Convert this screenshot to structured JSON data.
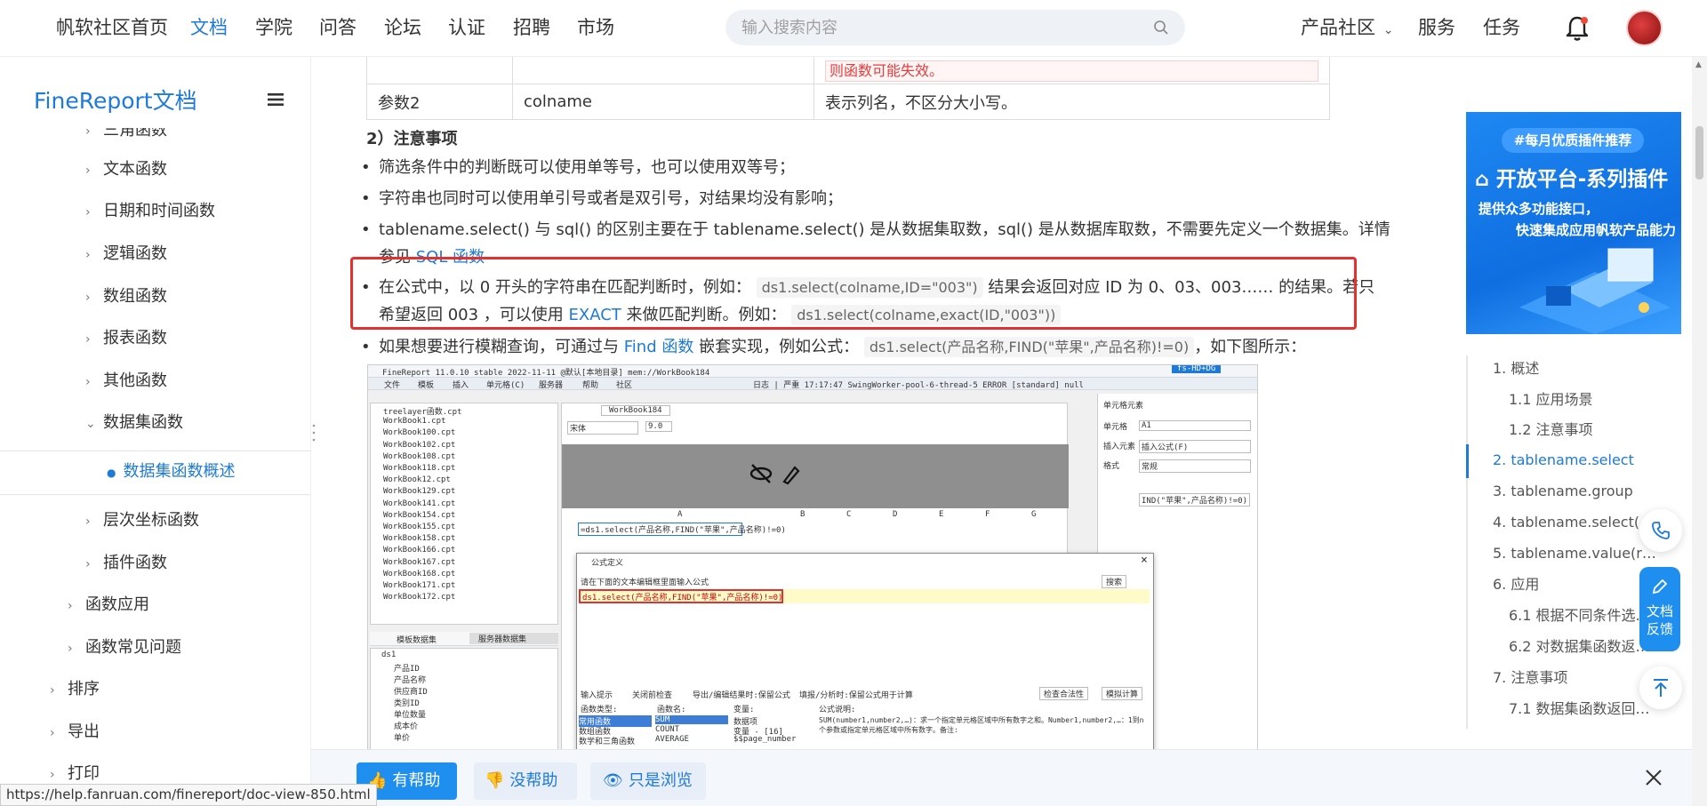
{
  "topnav": {
    "items": [
      "帆软社区首页",
      "文档",
      "学院",
      "问答",
      "论坛",
      "认证",
      "招聘",
      "市场"
    ],
    "active_index": 1,
    "search_placeholder": "输入搜索内容",
    "right_items": [
      "产品社区",
      "服务",
      "任务"
    ],
    "accent": "#1e7ad8"
  },
  "sidebar": {
    "title": "FineReport文档",
    "items": [
      {
        "label": "三角函数",
        "indent": 2
      },
      {
        "label": "文本函数",
        "indent": 2
      },
      {
        "label": "日期和时间函数",
        "indent": 2
      },
      {
        "label": "逻辑函数",
        "indent": 2
      },
      {
        "label": "数组函数",
        "indent": 2
      },
      {
        "label": "报表函数",
        "indent": 2
      },
      {
        "label": "其他函数",
        "indent": 2
      },
      {
        "label": "数据集函数",
        "indent": 2,
        "expanded": true
      },
      {
        "label": "数据集函数概述",
        "indent": 3,
        "active": true
      },
      {
        "label": "层次坐标函数",
        "indent": 2
      },
      {
        "label": "插件函数",
        "indent": 2
      },
      {
        "label": "函数应用",
        "indent": 1
      },
      {
        "label": "函数常见问题",
        "indent": 1
      },
      {
        "label": "排序",
        "indent": 0
      },
      {
        "label": "导出",
        "indent": 0
      },
      {
        "label": "打印",
        "indent": 0
      }
    ]
  },
  "content": {
    "param_table": {
      "row_warning": "则函数可能失效。",
      "row": {
        "name": "参数2",
        "param": "colname",
        "desc": "表示列名，不区分大小写。"
      }
    },
    "section_heading": "2）注意事项",
    "bullets": {
      "b1": "筛选条件中的判断既可以使用单等号，也可以使用双等号；",
      "b2": "字符串也同时可以使用单引号或者是双引号，对结果均没有影响；",
      "b3_line1": "tablename.select() 与 sql() 的区别主要在于 tablename.select() 是从数据集取数，sql() 是从数据库取数，不需要先定义一个数据集。详情",
      "b3_prefix": "参见 ",
      "b3_link": "SQL 函数",
      "b4_a": "在公式中，以 0 开头的字符串在匹配判断时，例如：",
      "b4_code1": "ds1.select(colname,ID=\"003\")",
      "b4_b": " 结果会返回对应 ID 为 0、03、003…… 的结果。若只",
      "b4_c": "希望返回 003 ，可以使用 ",
      "b4_link": "EXACT",
      "b4_d": " 来做匹配判断。例如：",
      "b4_code2": "ds1.select(colname,exact(ID,\"003\"))",
      "b5_a": "如果想要进行模糊查询，可通过与 ",
      "b5_link": "Find 函数",
      "b5_b": " 嵌套实现，例如公式：",
      "b5_code": "ds1.select(产品名称,FIND(\"苹果\",产品名称)!=0)",
      "b5_c": "，如下图所示："
    },
    "screenshot": {
      "title": "FineReport 11.0.10 stable 2022-11-11 @默认[本地目录] mem://WorkBook184",
      "menu": [
        "文件",
        "模板",
        "插入",
        "单元格(C)",
        "服务器",
        "帮助",
        "社区"
      ],
      "log_text": "日志 | 严重 17:17:47 SwingWorker-pool-6-thread-5 ERROR [standard] null",
      "tab_label": "WorkBook184",
      "font_name": "宋体",
      "font_size": "9.0",
      "files": [
        "treelayer函数.cpt",
        "WorkBook1.cpt",
        "WorkBook100.cpt",
        "WorkBook102.cpt",
        "WorkBook108.cpt",
        "WorkBook118.cpt",
        "WorkBook12.cpt",
        "WorkBook129.cpt",
        "WorkBook141.cpt",
        "WorkBook154.cpt",
        "WorkBook155.cpt",
        "WorkBook158.cpt",
        "WorkBook166.cpt",
        "WorkBook167.cpt",
        "WorkBook168.cpt",
        "WorkBook171.cpt",
        "WorkBook172.cpt"
      ],
      "ds_tabs": [
        "模板数据集",
        "服务器数据集"
      ],
      "ds_root": "ds1",
      "ds_fields": [
        "产品ID",
        "产品名称",
        "供应商ID",
        "类别ID",
        "单位数量",
        "成本价",
        "单价"
      ],
      "columns": [
        "A",
        "B",
        "C",
        "D",
        "E",
        "F",
        "G"
      ],
      "cell_a1": "=ds1.select(产品名称,FIND(\"苹果\",产品名称)!=0)",
      "props_title": "单元格元素",
      "props": [
        {
          "k": "单元格",
          "v": "A1"
        },
        {
          "k": "插入元素",
          "v": "插入公式(F)"
        },
        {
          "k": "格式",
          "v": "常规"
        }
      ],
      "props_formula": "IND(\"苹果\",产品名称)!=0)",
      "dialog_title": "公式定义",
      "dialog_hint": "请在下面的文本编辑框里面输入公式",
      "dialog_search": "搜索",
      "dialog_formula": "ds1.select(产品名称,FIND(\"苹果\",产品名称)!=0)",
      "dialog_options": [
        "输入提示",
        "关闭前检查",
        "导出/编辑结果时:保留公式",
        "填报/分析时:保留公式用于计算"
      ],
      "dialog_buttons": [
        "检查合法性",
        "模拟计算"
      ],
      "dialog_cols": [
        "函数类型:",
        "函数名:",
        "变量:",
        "公式说明:"
      ],
      "func_types": [
        "常用函数",
        "数组函数",
        "数学和三角函数"
      ],
      "func_names": [
        "SUM",
        "COUNT",
        "AVERAGE"
      ],
      "vars": [
        "数据项",
        "变量 - [16]",
        "$$page_number"
      ],
      "formula_desc": "SUM(number1,number2,…)：求一个指定单元格区域中所有数字之和。Number1,number2,…：1到n个参数或指定单元格区域中所有数字。备注:"
    }
  },
  "ad": {
    "badge": "#每月优质插件推荐",
    "title": "开放平台-系列插件",
    "sub1": "提供众多功能接口，",
    "sub2": "快速集成应用帆软产品能力"
  },
  "toc": [
    {
      "label": "1. 概述",
      "level": 1
    },
    {
      "label": "1.1 应用场景",
      "level": 2
    },
    {
      "label": "1.2 注意事项",
      "level": 2
    },
    {
      "label": "2. tablename.select",
      "level": 1,
      "active": true
    },
    {
      "label": "3. tablename.group",
      "level": 1
    },
    {
      "label": "4. tablename.select(…",
      "level": 1
    },
    {
      "label": "5. tablename.value(r…",
      "level": 1
    },
    {
      "label": "6. 应用",
      "level": 1
    },
    {
      "label": "6.1 根据不同条件选…",
      "level": 2
    },
    {
      "label": "6.2 对数据集函数返…",
      "level": 2
    },
    {
      "label": "7. 注意事项",
      "level": 1
    },
    {
      "label": "7.1 数据集函数返回…",
      "level": 2
    }
  ],
  "feedback_label": "文档反馈",
  "bottom_bar": {
    "helpful": "有帮助",
    "not_helpful": "没帮助",
    "just_browse": "只是浏览"
  },
  "status_url": "https://help.fanruan.com/finereport/doc-view-850.html"
}
